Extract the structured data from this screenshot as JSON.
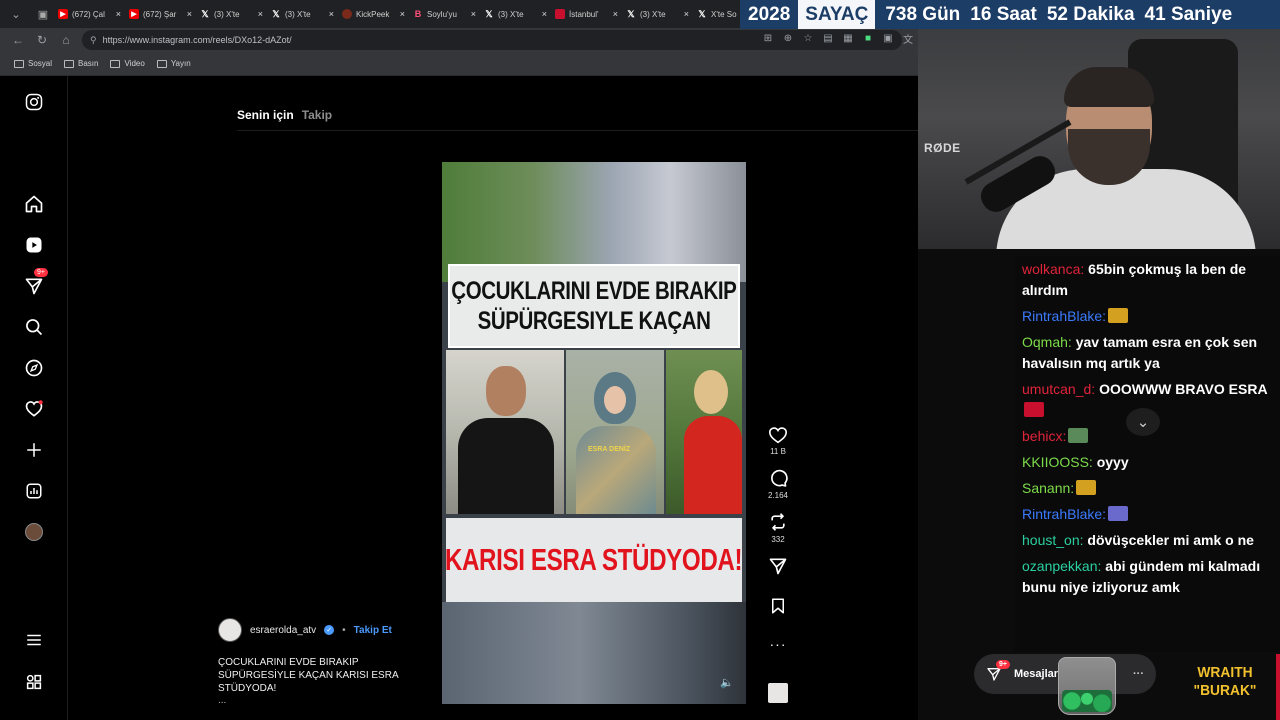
{
  "browser": {
    "tabs": [
      {
        "icon": "youtube-icon",
        "label": "(672) Çal"
      },
      {
        "icon": "youtube-icon",
        "label": "(672) Şar"
      },
      {
        "icon": "x-logo-icon",
        "label": "(3) X'te"
      },
      {
        "icon": "x-logo-icon",
        "label": "(3) X'te"
      },
      {
        "icon": "kickpeek-icon",
        "label": "KickPeek"
      },
      {
        "icon": "b-logo-icon",
        "label": "Soylu'yu"
      },
      {
        "icon": "x-logo-icon",
        "label": "(3) X'te"
      },
      {
        "icon": "istanbul-icon",
        "label": "İstanbul'"
      },
      {
        "icon": "x-logo-icon",
        "label": "(3) X'te"
      },
      {
        "icon": "x-logo-icon",
        "label": "X'te So"
      }
    ],
    "url": "https://www.instagram.com/reels/DXo12-dAZot/",
    "bookmarks": [
      "Sosyal",
      "Basın",
      "Video",
      "Yayın"
    ]
  },
  "instagram": {
    "feed_tabs": {
      "active": "Senin için",
      "inactive": "Takip"
    },
    "notification_badge": "9+",
    "reel": {
      "headline_line1": "ÇOCUKLARINI EVDE BIRAKIP",
      "headline_line2": "SÜPÜRGESIYLE KAÇAN",
      "name_tag": "ESRA DENİZ",
      "subtitle": "KARISI ESRA STÜDYODA!",
      "author": "esraerolda_atv",
      "follow_label": "Takip Et",
      "caption": "ÇOCUKLARINI EVDE BIRAKIP SÜPÜRGESİYLE KAÇAN KARISI ESRA STÜDYODA!",
      "more": "..."
    },
    "actions": {
      "likes": "11 B",
      "comments": "2.164",
      "reposts": "332"
    }
  },
  "stream": {
    "counter": {
      "year": "2028",
      "label": "SAYAÇ",
      "days": "738 Gün",
      "hours": "16 Saat",
      "minutes": "52 Dakika",
      "seconds": "41 Saniye"
    },
    "cam_brand": "RØDE",
    "chat": [
      {
        "user": "wolkanca:",
        "text": "65bin çokmuş la ben de alırdım",
        "color": "#e0243a"
      },
      {
        "user": "RintrahBlake:",
        "text": "",
        "color": "#3b7bff",
        "emote": true
      },
      {
        "user": "Oqmah:",
        "text": "yav tamam esra en çok sen havalısın mq artık ya",
        "color": "#7ddc4a"
      },
      {
        "user": "umutcan_d:",
        "text": "OOOWWW BRAVO ESRA",
        "color": "#e0243a",
        "emote": true
      },
      {
        "user": "behicx:",
        "text": "",
        "color": "#e0243a",
        "emote": true
      },
      {
        "user": "KKIIOOSS:",
        "text": "oyyy",
        "color": "#7ddc4a"
      },
      {
        "user": "Sanann:",
        "text": "",
        "color": "#7ddc4a",
        "emote": true
      },
      {
        "user": "RintrahBlake:",
        "text": "",
        "color": "#3b7bff",
        "emote": true
      },
      {
        "user": "houst_on:",
        "text": "dövüşcekler mi amk o ne",
        "color": "#2bd0a0"
      },
      {
        "user": "ozanpekkan:",
        "text": "abi gündem mi kalmadı bunu niye izliyoruz amk",
        "color": "#2bd0a0"
      }
    ],
    "messages_label": "Mesajlar",
    "messages_badge": "9+",
    "overlay_line1": "WRAITH",
    "overlay_line2": "\"BURAK\""
  }
}
